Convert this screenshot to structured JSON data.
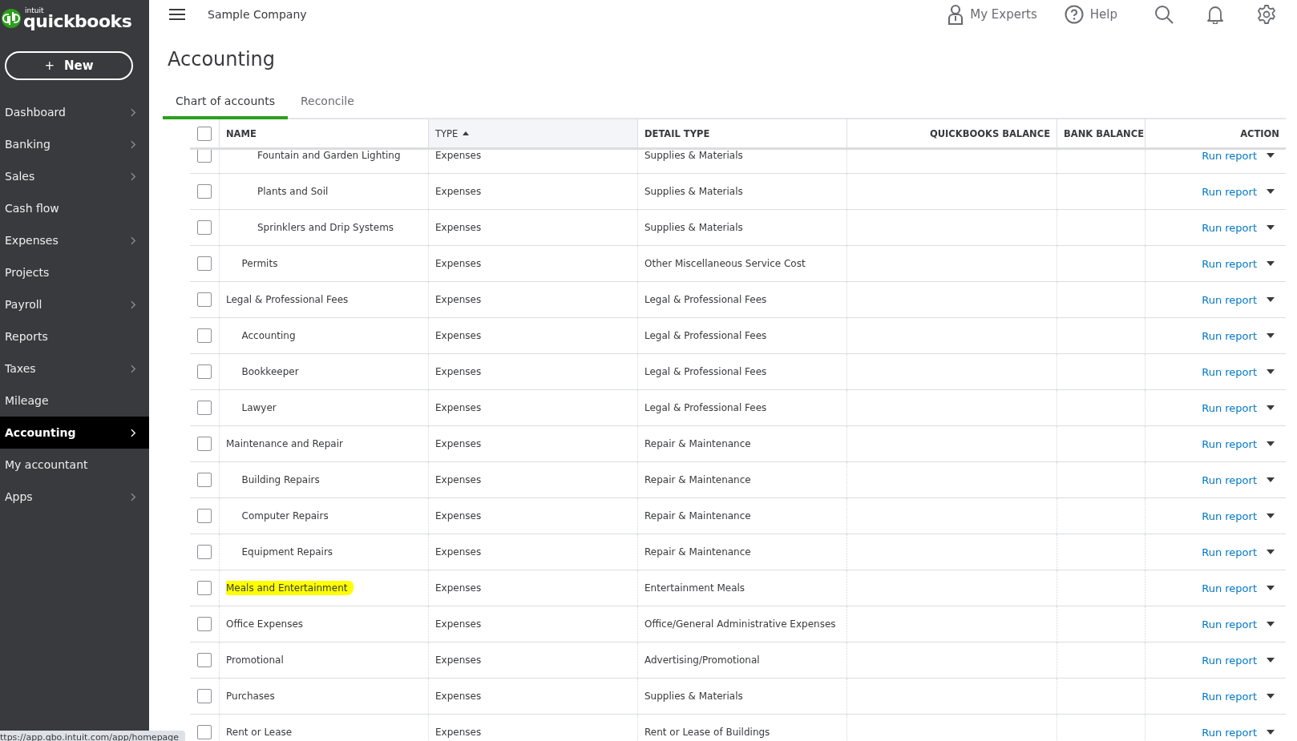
{
  "brand": {
    "small": "intuit",
    "name": "quickbooks"
  },
  "new_button": {
    "icon": "+",
    "label": "New"
  },
  "sidebar": {
    "items": [
      {
        "label": "Dashboard",
        "has_submenu": true,
        "selected": false
      },
      {
        "label": "Banking",
        "has_submenu": true,
        "selected": false
      },
      {
        "label": "Sales",
        "has_submenu": true,
        "selected": false
      },
      {
        "label": "Cash flow",
        "has_submenu": false,
        "selected": false
      },
      {
        "label": "Expenses",
        "has_submenu": true,
        "selected": false
      },
      {
        "label": "Projects",
        "has_submenu": false,
        "selected": false
      },
      {
        "label": "Payroll",
        "has_submenu": true,
        "selected": false
      },
      {
        "label": "Reports",
        "has_submenu": false,
        "selected": false
      },
      {
        "label": "Taxes",
        "has_submenu": true,
        "selected": false
      },
      {
        "label": "Mileage",
        "has_submenu": false,
        "selected": false
      },
      {
        "label": "Accounting",
        "has_submenu": true,
        "selected": true
      },
      {
        "label": "My accountant",
        "has_submenu": false,
        "selected": false
      },
      {
        "label": "Apps",
        "has_submenu": true,
        "selected": false
      }
    ]
  },
  "top_bar": {
    "company": "Sample Company",
    "my_experts": "My Experts",
    "help": "Help"
  },
  "page_title": "Accounting",
  "tabs": [
    {
      "label": "Chart of accounts",
      "selected": true
    },
    {
      "label": "Reconcile",
      "selected": false
    }
  ],
  "table": {
    "select_all_checked": false,
    "columns": [
      {
        "label": "NAME",
        "sorted": false
      },
      {
        "label": "TYPE",
        "sorted": true
      },
      {
        "label": "DETAIL TYPE",
        "sorted": false
      },
      {
        "label": "QUICKBOOKS BALANCE",
        "sorted": false
      },
      {
        "label": "BANK BALANCE",
        "sorted": false
      },
      {
        "label": "ACTION",
        "sorted": false
      }
    ],
    "rows": [
      {
        "children": [
          {
            "children": [
              {
                "name": "Fountain and Garden Lighting",
                "type": "Expenses",
                "detail_type": "Supplies & Materials",
                "action": "Run report",
                "checked": false,
                "highlighted": false
              },
              {
                "name": "Plants and Soil",
                "type": "Expenses",
                "detail_type": "Supplies & Materials",
                "action": "Run report",
                "checked": false,
                "highlighted": false
              },
              {
                "name": "Sprinklers and Drip Systems",
                "type": "Expenses",
                "detail_type": "Supplies & Materials",
                "action": "Run report",
                "checked": false,
                "highlighted": false
              }
            ]
          },
          {
            "name": "Permits",
            "type": "Expenses",
            "detail_type": "Other Miscellaneous Service Cost",
            "action": "Run report",
            "checked": false,
            "highlighted": false
          }
        ]
      },
      {
        "name": "Legal & Professional Fees",
        "type": "Expenses",
        "detail_type": "Legal & Professional Fees",
        "action": "Run report",
        "checked": false,
        "highlighted": false,
        "children": [
          {
            "name": "Accounting",
            "type": "Expenses",
            "detail_type": "Legal & Professional Fees",
            "action": "Run report",
            "checked": false,
            "highlighted": false
          },
          {
            "name": "Bookkeeper",
            "type": "Expenses",
            "detail_type": "Legal & Professional Fees",
            "action": "Run report",
            "checked": false,
            "highlighted": false
          },
          {
            "name": "Lawyer",
            "type": "Expenses",
            "detail_type": "Legal & Professional Fees",
            "action": "Run report",
            "checked": false,
            "highlighted": false
          }
        ]
      },
      {
        "name": "Maintenance and Repair",
        "type": "Expenses",
        "detail_type": "Repair & Maintenance",
        "action": "Run report",
        "checked": false,
        "highlighted": false,
        "children": [
          {
            "name": "Building Repairs",
            "type": "Expenses",
            "detail_type": "Repair & Maintenance",
            "action": "Run report",
            "checked": false,
            "highlighted": false
          },
          {
            "name": "Computer Repairs",
            "type": "Expenses",
            "detail_type": "Repair & Maintenance",
            "action": "Run report",
            "checked": false,
            "highlighted": false
          },
          {
            "name": "Equipment Repairs",
            "type": "Expenses",
            "detail_type": "Repair & Maintenance",
            "action": "Run report",
            "checked": false,
            "highlighted": false
          }
        ]
      },
      {
        "name": "Meals and Entertainment",
        "type": "Expenses",
        "detail_type": "Entertainment Meals",
        "action": "Run report",
        "checked": false,
        "highlighted": true
      },
      {
        "name": "Office Expenses",
        "type": "Expenses",
        "detail_type": "Office/General Administrative Expenses",
        "action": "Run report",
        "checked": false,
        "highlighted": false
      },
      {
        "name": "Promotional",
        "type": "Expenses",
        "detail_type": "Advertising/Promotional",
        "action": "Run report",
        "checked": false,
        "highlighted": false
      },
      {
        "name": "Purchases",
        "type": "Expenses",
        "detail_type": "Supplies & Materials",
        "action": "Run report",
        "checked": false,
        "highlighted": false
      },
      {
        "name": "Rent or Lease",
        "type": "Expenses",
        "detail_type": "Rent or Lease of Buildings",
        "action": "Run report",
        "checked": false,
        "highlighted": false
      }
    ]
  },
  "status_url": "ttps://app.qbo.intuit.com/app/homepage"
}
